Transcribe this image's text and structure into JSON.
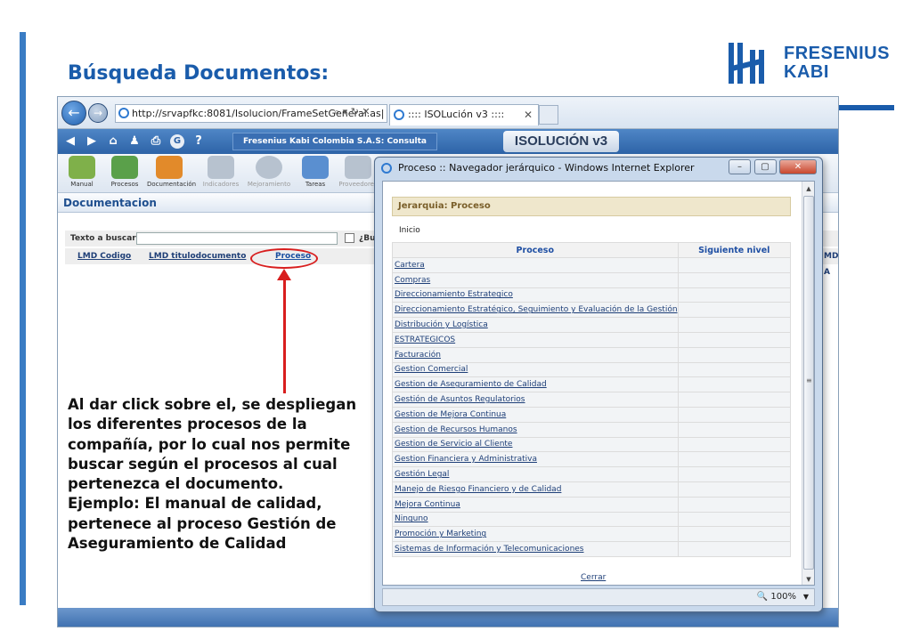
{
  "slide": {
    "title": "Búsqueda Documentos:",
    "logo_line1": "FRESENIUS",
    "logo_line2": "KABI",
    "accent_color": "#1a5cab"
  },
  "browser": {
    "address": "http://srvapfkc:8081/Isolucion/FrameSetGeneral.as|",
    "tab_title": ":::: ISOLución v3 ::::",
    "company_label": "Fresenius Kabi Colombia S.A.S: Consulta",
    "app_logo": "ISOLUCIÓN v3",
    "modules": [
      {
        "label": "Manual",
        "icon": "book-icon",
        "color": "#7fb04a",
        "active": true
      },
      {
        "label": "Procesos",
        "icon": "cubes-icon",
        "color": "#5aa04a",
        "active": true
      },
      {
        "label": "Documentación",
        "icon": "folder-icon",
        "color": "#e28a2a",
        "active": true
      },
      {
        "label": "Indicadores",
        "icon": "chart-icon",
        "color": "#b7c2cf",
        "active": false
      },
      {
        "label": "Mejoramiento",
        "icon": "compass-icon",
        "color": "#b7c2cf",
        "active": false
      },
      {
        "label": "Tareas",
        "icon": "laptop-icon",
        "color": "#5a8fd0",
        "active": true
      },
      {
        "label": "Proveedores",
        "icon": "box-icon",
        "color": "#b7c2cf",
        "active": false
      }
    ],
    "section_title": "Documentacion",
    "search_label": "Texto a buscar:",
    "search_value": "",
    "search_check_label": "¿Bu",
    "columns": [
      "LMD Codigo",
      "LMD titulodocumento",
      "Proceso"
    ],
    "column_right": "MD A"
  },
  "note": {
    "paragraph1": "Al dar click sobre el, se despliegan los diferentes procesos de la compañía, por lo cual nos permite buscar según el procesos al cual pertenezca el documento.",
    "paragraph2": "Ejemplo: El manual de calidad, pertenece al proceso Gestión de Aseguramiento de Calidad"
  },
  "popup": {
    "title": "Proceso :: Navegador jerárquico - Windows Internet Explorer",
    "heading": "Jerarquia: Proceso",
    "breadcrumb": "Inicio",
    "col_proceso": "Proceso",
    "col_siguiente": "Siguiente nivel",
    "rows": [
      "Cartera",
      "Compras",
      "Direccionamiento Estrategico",
      "Direccionamiento Estratégico, Seguimiento y Evaluación de la Gestión",
      "Distribución y Logística",
      "ESTRATEGICOS",
      "Facturación",
      "Gestion Comercial",
      "Gestion de Aseguramiento de Calidad",
      "Gestión de Asuntos Regulatorios",
      "Gestion de Mejora Continua",
      "Gestion de Recursos Humanos",
      "Gestion de Servicio al Cliente",
      "Gestion Financiera y Administrativa",
      "Gestión Legal",
      "Manejo de Riesgo Financiero y de Calidad",
      "Mejora Continua",
      "Ninguno",
      "Promoción y Marketing",
      "Sistemas de Información y Telecomunicaciones"
    ],
    "close_link": "Cerrar",
    "zoom": "100%"
  }
}
